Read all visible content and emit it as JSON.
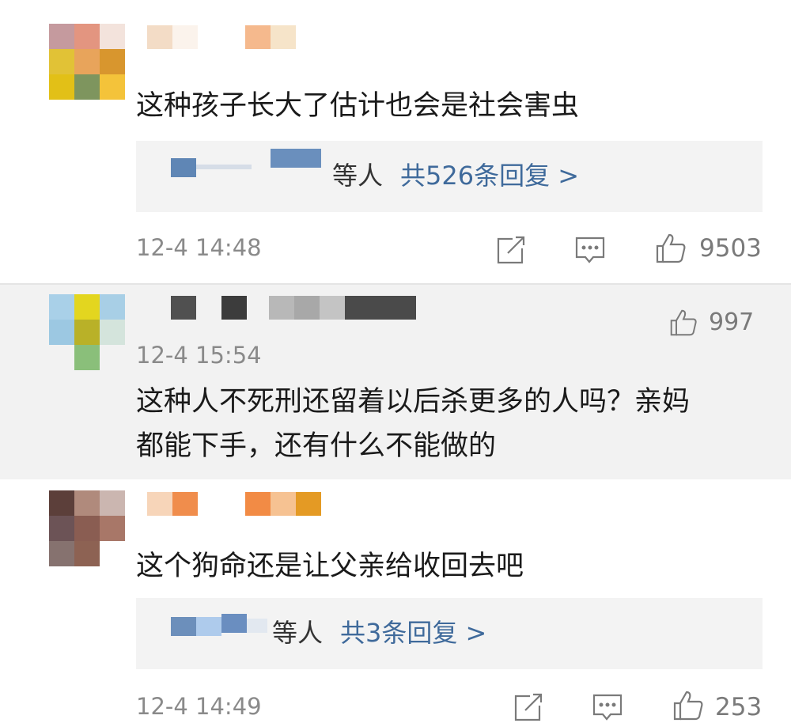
{
  "comments": [
    {
      "text": "这种孩子长大了估计也会是社会害虫",
      "reply_prefix": "等人",
      "reply_count_label": "共526条回复 >",
      "time": "12-4 14:48",
      "likes": "9503"
    },
    {
      "text_line1": "这种人不死刑还留着以后杀更多的人吗？亲妈",
      "text_line2": "都能下手，还有什么不能做的",
      "time": "12-4 15:54",
      "likes": "997"
    },
    {
      "text": "这个狗命还是让父亲给收回去吧",
      "reply_prefix": "等人",
      "reply_count_label": "共3条回复 >",
      "time": "12-4 14:49",
      "likes": "253"
    }
  ],
  "icons": {
    "share": "share-icon",
    "comment": "comment-icon",
    "like": "thumbs-up-icon"
  },
  "colors": {
    "reply_link": "#3f6a9b",
    "meta_text": "#8a8a8a",
    "highlight_bg": "#f2f2f2"
  }
}
